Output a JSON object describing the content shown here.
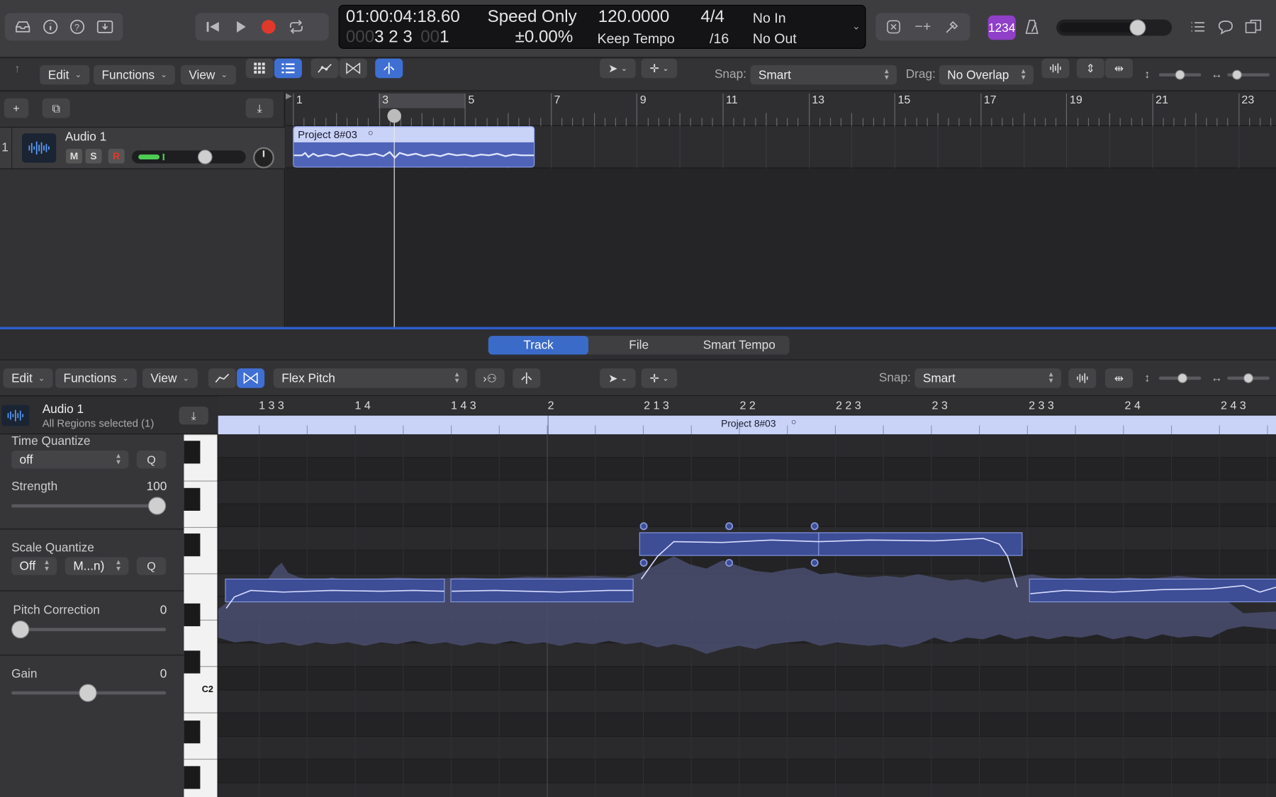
{
  "control_bar": {
    "buttons": [
      "inbox-icon",
      "info-icon",
      "help-icon",
      "download-icon"
    ],
    "transport": [
      "rewind-icon",
      "play-icon",
      "record-icon",
      "cycle-icon"
    ],
    "lcd": {
      "time": "01:00:04:18.60",
      "bars_prefix": "000",
      "bars": "3  2  3",
      "ticks_prefix": "00",
      "ticks": "1",
      "mode": "Speed Only",
      "percent": "±0.00%",
      "tempo": "120.0000",
      "tempo_mode": "Keep Tempo",
      "signature": "4/4",
      "division": "/16",
      "in": "No In",
      "out": "No Out"
    },
    "count_in": "1234",
    "master_volume": 0.74
  },
  "tracks_toolbar": {
    "edit": "Edit",
    "functions": "Functions",
    "view": "View",
    "snap_label": "Snap:",
    "snap_value": "Smart",
    "drag_label": "Drag:",
    "drag_value": "No Overlap"
  },
  "tracks_ruler": [
    "1",
    "3",
    "5",
    "7",
    "9",
    "11",
    "13",
    "15",
    "17",
    "19",
    "21",
    "23"
  ],
  "track": {
    "number": "1",
    "name": "Audio 1",
    "mute": "M",
    "solo": "S",
    "record": "R",
    "region_name": "Project 8#03"
  },
  "editor": {
    "tabs": [
      "Track",
      "File",
      "Smart Tempo"
    ],
    "active_tab": "Track",
    "edit": "Edit",
    "functions": "Functions",
    "view": "View",
    "flex_mode": "Flex Pitch",
    "snap_label": "Snap:",
    "snap_value": "Smart",
    "ruler": [
      "1 3 3",
      "1 4",
      "1 4 3",
      "2",
      "2 1 3",
      "2 2",
      "2 2 3",
      "2 3",
      "2 3 3",
      "2 4",
      "2 4 3"
    ],
    "region_name": "Project 8#03",
    "piano_note": "C2"
  },
  "inspector": {
    "track_name": "Audio 1",
    "selection": "All Regions selected (1)",
    "time_quantize_label": "Time Quantize",
    "time_quantize_value": "off",
    "q": "Q",
    "strength_label": "Strength",
    "strength_value": "100",
    "scale_quantize_label": "Scale Quantize",
    "scale_value": "Off",
    "scale_mode": "M...n)",
    "pitch_correction_label": "Pitch Correction",
    "pitch_correction_value": "0",
    "gain_label": "Gain",
    "gain_value": "0"
  },
  "colors": {
    "accent": "#3f6fd3",
    "region": "#5a6fbf",
    "record": "#e0392b",
    "count_in": "#8f3fc8"
  }
}
